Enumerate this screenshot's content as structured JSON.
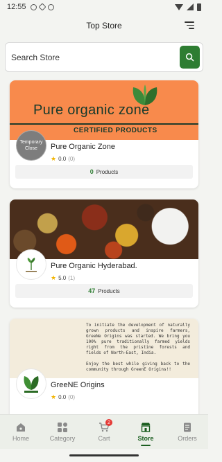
{
  "status_bar": {
    "time": "12:55"
  },
  "header": {
    "title": "Top Store"
  },
  "search": {
    "placeholder": "Search Store"
  },
  "stores": [
    {
      "name": "Pure Organic Zone",
      "rating": "0.0",
      "reviews": "(0)",
      "products_count": "0",
      "products_label": "Products",
      "status_overlay": "Temporary Close",
      "banner_title": "Pure organic zone",
      "banner_subtitle": "CERTIFIED PRODUCTS"
    },
    {
      "name": "Pure Organic Hyderabad.",
      "rating": "5.0",
      "reviews": "(1)",
      "products_count": "47",
      "products_label": "Products"
    },
    {
      "name": "GreeNE Origins",
      "rating": "0.0",
      "reviews": "(0)",
      "banner_text_1": "To initiate the development of naturally grown products and inspire farmers, GreeNe Origins was started. We bring you 100% pure traditionally farmed yields right from the pristine forests and fields of North-East, India.",
      "banner_text_2": "Enjoy the best while giving back to the community through GreenE Origins!!"
    }
  ],
  "nav": {
    "home": "Home",
    "category": "Category",
    "cart": "Cart",
    "cart_badge": "2",
    "store": "Store",
    "orders": "Orders"
  },
  "colors": {
    "primary": "#2e7d32",
    "banner_orange": "#f88a4c"
  }
}
